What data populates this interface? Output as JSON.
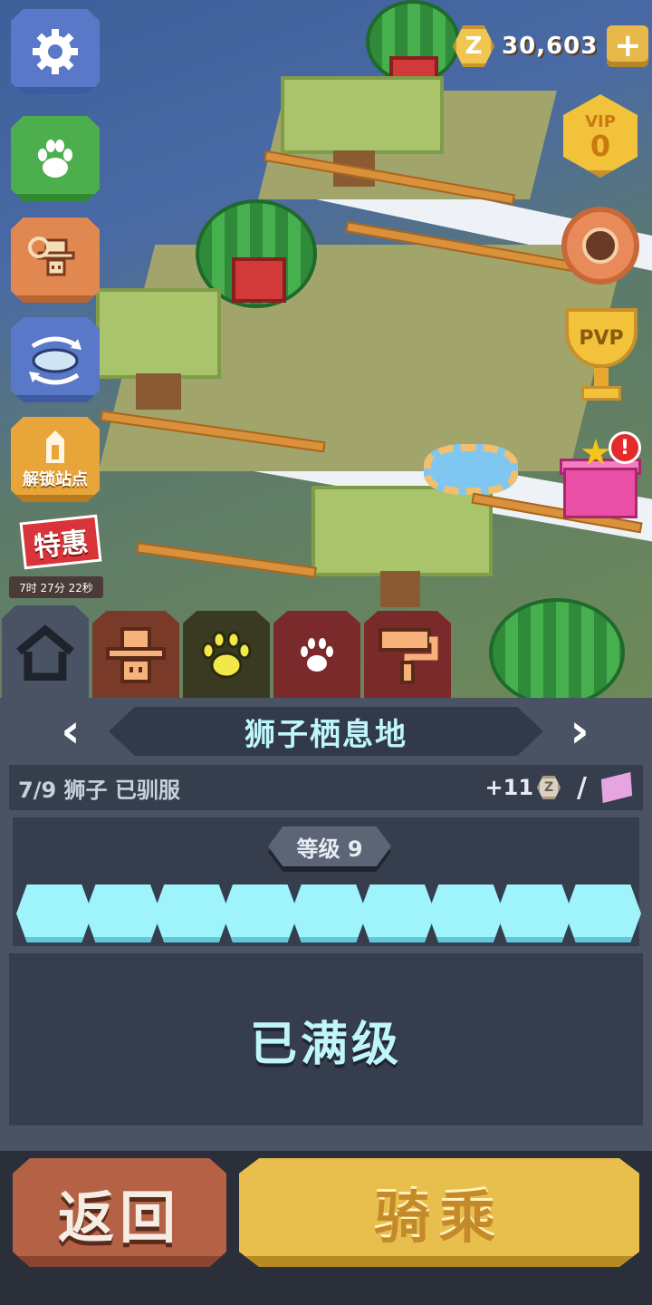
{
  "hud": {
    "coins": "30,603",
    "coin_symbol": "Z",
    "vip_label": "VIP",
    "vip_level": "0",
    "pvp_label": "PVP",
    "gift_alert": "!"
  },
  "side": {
    "unlock_station": "解锁站点",
    "special_label": "特惠",
    "special_timer": "7时 27分 22秒"
  },
  "tabs": [
    {
      "name": "home",
      "icon": "house-icon",
      "active": true
    },
    {
      "name": "keeper",
      "icon": "cowboy-icon"
    },
    {
      "name": "pets",
      "icon": "paw-icon"
    },
    {
      "name": "animals",
      "icon": "paw-icon"
    },
    {
      "name": "decor",
      "icon": "paint-roller-icon"
    }
  ],
  "panel": {
    "title": "狮子栖息地",
    "tamed": "7/9 狮子 已驯服",
    "reward": "+11",
    "reward_slash": "/",
    "level_label": "等级 9",
    "progress_segments": 9,
    "progress_filled": 9,
    "status": "已满级"
  },
  "buttons": {
    "back": "返回",
    "ride": "骑乘"
  },
  "colors": {
    "panel_bg": "#4a5364",
    "panel_dark": "#363e4e",
    "progress_fill": "#9ff3fb",
    "title_text": "#bff6fb",
    "back_button": "#b46146",
    "ride_button": "#e8be4c"
  }
}
